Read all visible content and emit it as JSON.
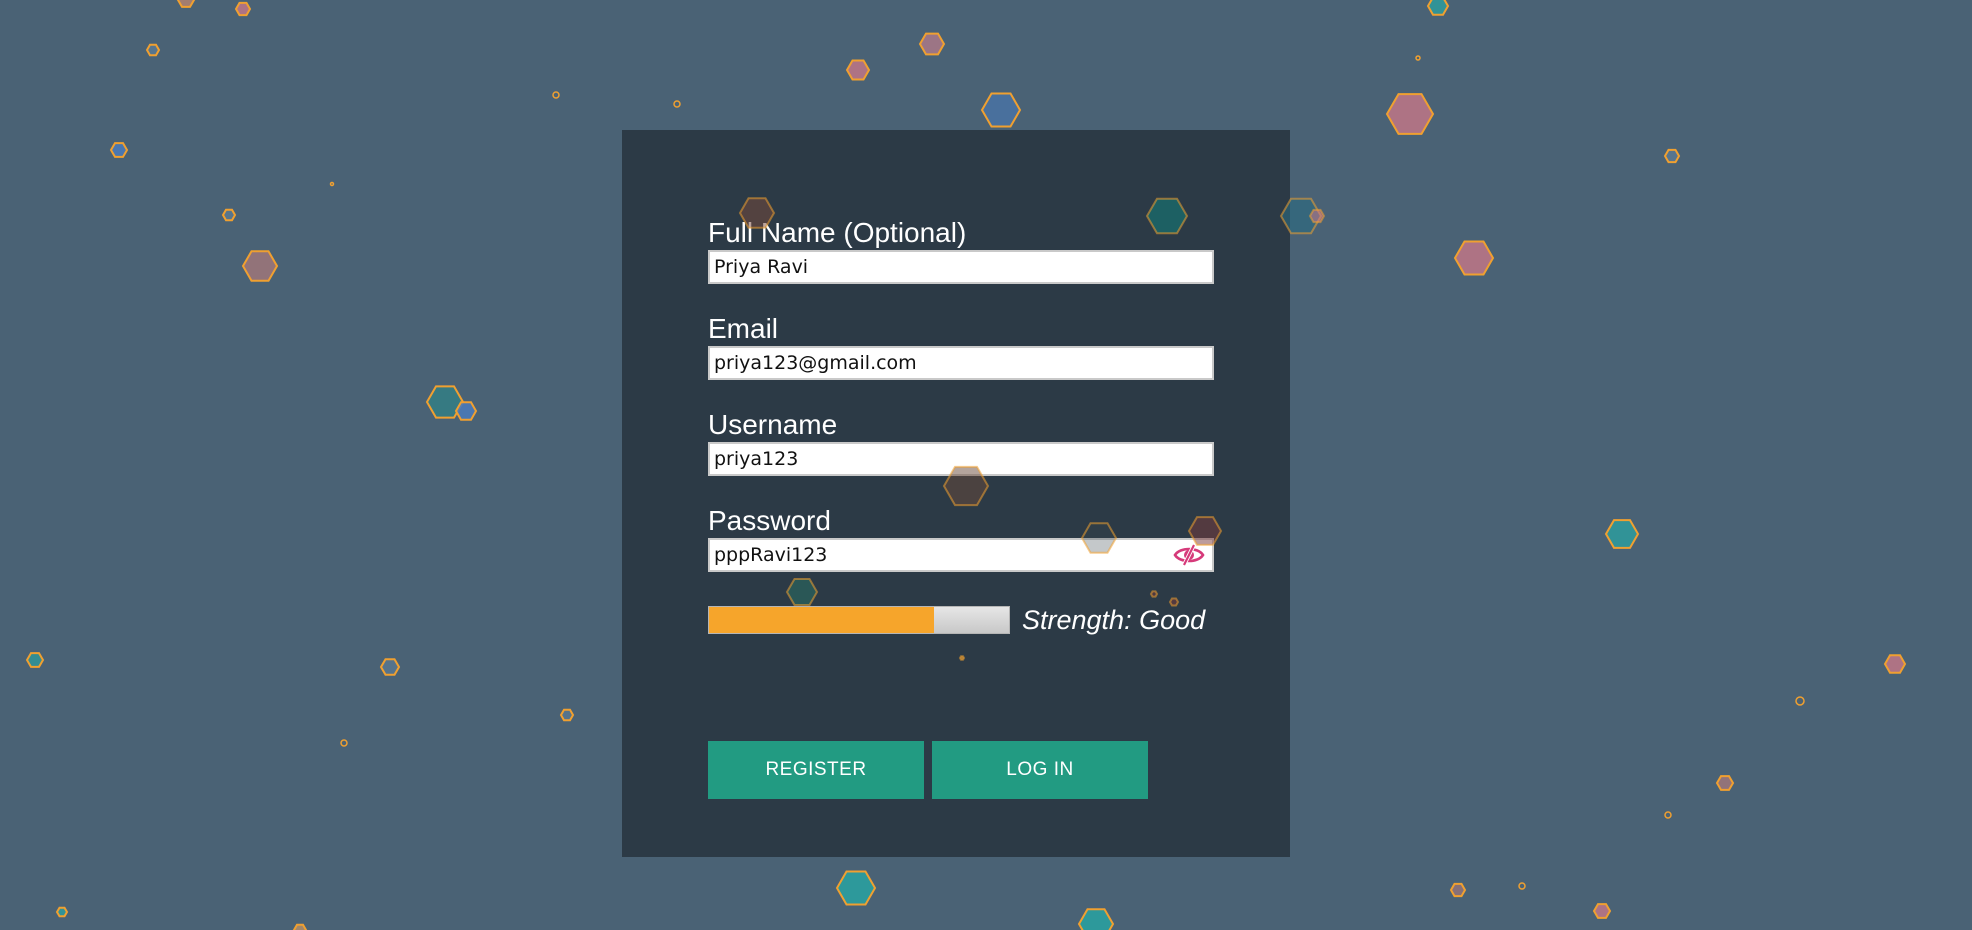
{
  "form": {
    "full_name": {
      "label": "Full Name (Optional)",
      "value": "Priya Ravi"
    },
    "email": {
      "label": "Email",
      "value": "priya123@gmail.com"
    },
    "username": {
      "label": "Username",
      "value": "priya123"
    },
    "password": {
      "label": "Password",
      "value": "pppRavi123",
      "toggle_icon": "eye-slash-icon"
    }
  },
  "strength": {
    "text": "Strength: Good",
    "level": 0.75,
    "fill_color": "#f6a52b"
  },
  "buttons": {
    "register_label": "REGISTER",
    "login_label": "LOG IN"
  },
  "colors": {
    "background": "#4a6275",
    "card": "#2c3a46",
    "button": "#229b82",
    "accent": "#f6a52b",
    "eye_icon": "#d63a7a"
  }
}
